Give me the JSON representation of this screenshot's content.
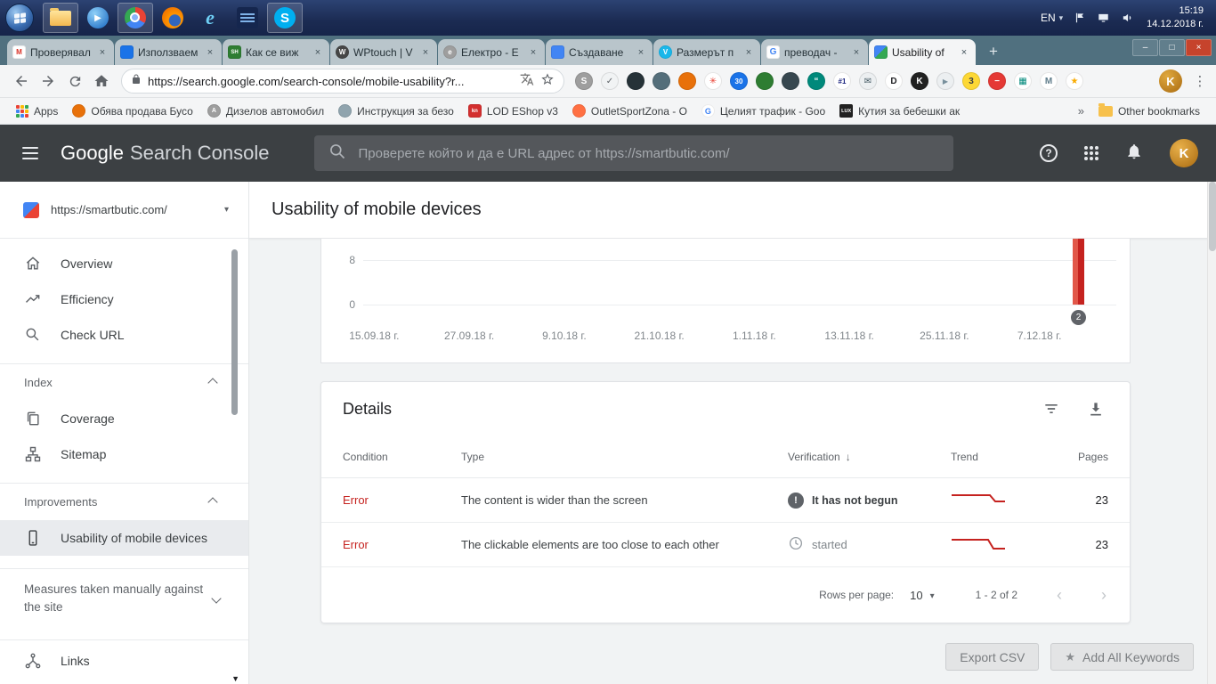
{
  "colors": {
    "error_red": "#d93025",
    "chart_bar_red": "#c5221f",
    "gsc_header_bg": "#3c4043",
    "selected_nav_bg": "#e9ebee",
    "taskbar_blue": "#1b2b52"
  },
  "taskbar": {
    "apps": [
      "windows-explorer",
      "windows-media-player",
      "chrome",
      "firefox",
      "internet-explorer",
      "remote-app",
      "skype"
    ],
    "language": "EN",
    "time": "15:19",
    "date": "14.12.2018 г."
  },
  "browser": {
    "tabs": [
      {
        "label": "Проверявал",
        "glyph": "M"
      },
      {
        "label": "Използваем",
        "glyph": ""
      },
      {
        "label": "Как се виж",
        "glyph": "SH"
      },
      {
        "label": "WPtouch | V",
        "glyph": "W"
      },
      {
        "label": "Електро - Е",
        "glyph": "e"
      },
      {
        "label": "Създаване",
        "glyph": ""
      },
      {
        "label": "Размерът п",
        "glyph": "V"
      },
      {
        "label": "преводач -",
        "glyph": "G"
      },
      {
        "label": "Usability of",
        "glyph": ""
      }
    ],
    "url": "https://search.google.com/search-console/mobile-usability?r...",
    "profile_initial": "K",
    "bookmarks_apps_label": "Apps",
    "bookmarks": [
      {
        "label": "Обява продава Бусо",
        "glyph": ""
      },
      {
        "label": "Дизелов автомобил",
        "glyph": "A"
      },
      {
        "label": "Инструкция за безо",
        "glyph": ""
      },
      {
        "label": "LOD EShop v3",
        "glyph": "kn"
      },
      {
        "label": "OutletSportZona - O",
        "glyph": ""
      },
      {
        "label": "Целият трафик - Goo",
        "glyph": "G"
      },
      {
        "label": "Кутия за бебешки ак",
        "glyph": "LUX"
      }
    ],
    "other_bookmarks": "Other bookmarks",
    "extensions": [
      {
        "name": "ext-s",
        "glyph": "S"
      },
      {
        "name": "ext-check",
        "glyph": "✓"
      },
      {
        "name": "ext-dark-circle",
        "glyph": ""
      },
      {
        "name": "ext-screen",
        "glyph": ""
      },
      {
        "name": "ext-orange",
        "glyph": ""
      },
      {
        "name": "ext-asterisk",
        "glyph": "✳"
      },
      {
        "name": "ext-calendar-30",
        "glyph": "30"
      },
      {
        "name": "ext-green-dot",
        "glyph": ""
      },
      {
        "name": "ext-tv",
        "glyph": ""
      },
      {
        "name": "ext-quote",
        "glyph": "“"
      },
      {
        "name": "ext-hash-1",
        "glyph": "#1"
      },
      {
        "name": "ext-mail",
        "glyph": "✉"
      },
      {
        "name": "ext-d",
        "glyph": "D"
      },
      {
        "name": "ext-k",
        "glyph": "K"
      },
      {
        "name": "ext-play",
        "glyph": "▶"
      },
      {
        "name": "ext-badge-3",
        "glyph": "3"
      },
      {
        "name": "ext-stop",
        "glyph": "−"
      },
      {
        "name": "ext-grid",
        "glyph": "▦"
      },
      {
        "name": "ext-m",
        "glyph": "M"
      },
      {
        "name": "ext-star",
        "glyph": "★"
      }
    ],
    "window_controls": {
      "minimize": "–",
      "maximize": "□",
      "close": "×"
    }
  },
  "gsc": {
    "logo_part1": "Google",
    "logo_part2": "Search Console",
    "search_placeholder": "Проверете който и да е URL адрес от https://smartbutic.com/",
    "avatar_initial": "K"
  },
  "sidebar": {
    "property_url": "https://smartbutic.com/",
    "items": [
      {
        "label": "Overview",
        "icon": "home-icon"
      },
      {
        "label": "Efficiency",
        "icon": "trending-up-icon"
      },
      {
        "label": "Check URL",
        "icon": "search-icon"
      }
    ],
    "sections": [
      {
        "title": "Index",
        "items": [
          {
            "label": "Coverage",
            "icon": "coverage-icon"
          },
          {
            "label": "Sitemap",
            "icon": "sitemap-icon"
          }
        ]
      },
      {
        "title": "Improvements",
        "items": [
          {
            "label": "Usability of mobile devices",
            "icon": "smartphone-icon",
            "selected": true
          }
        ]
      }
    ],
    "manual_actions_label": "Measures taken manually against the site",
    "links_label": "Links"
  },
  "main": {
    "page_title": "Usability of mobile devices",
    "details": {
      "title": "Details",
      "columns": [
        "Condition",
        "Type",
        "Verification",
        "Trend",
        "Pages"
      ],
      "sort_column": "Verification",
      "rows": [
        {
          "condition": "Error",
          "type": "The content is wider than the screen",
          "verification_state": "It has not begun",
          "verification_icon": "alert-icon",
          "pages": "23"
        },
        {
          "condition": "Error",
          "type": "The clickable elements are too close to each other",
          "verification_state": "started",
          "verification_icon": "clock-icon",
          "pages": "23"
        }
      ],
      "pagination": {
        "rows_per_page_label": "Rows per page:",
        "rows_per_page_value": "10",
        "range_label": "1 - 2 of 2"
      }
    },
    "footer_buttons": {
      "export_csv": "Export CSV",
      "add_all_keywords": "Add All Keywords"
    }
  },
  "chart_data": {
    "type": "bar",
    "title": "Usability of mobile devices — mobile usability errors over time (top of chart scrolled out of view)",
    "x_tick_labels": [
      "15.09.18 г.",
      "27.09.18 г.",
      "9.10.18 г.",
      "21.10.18 г.",
      "1.11.18 г.",
      "13.11.18 г.",
      "25.11.18 г.",
      "7.12.18 г."
    ],
    "visible_y_ticks": [
      "8",
      "0"
    ],
    "series": [
      {
        "name": "Error",
        "color": "#d93025"
      }
    ],
    "visible_bars": [
      {
        "position": "rightmost, after 7.12.18 г.",
        "top_clipped": true
      }
    ],
    "selected_point_badge": "2",
    "grid": true
  }
}
